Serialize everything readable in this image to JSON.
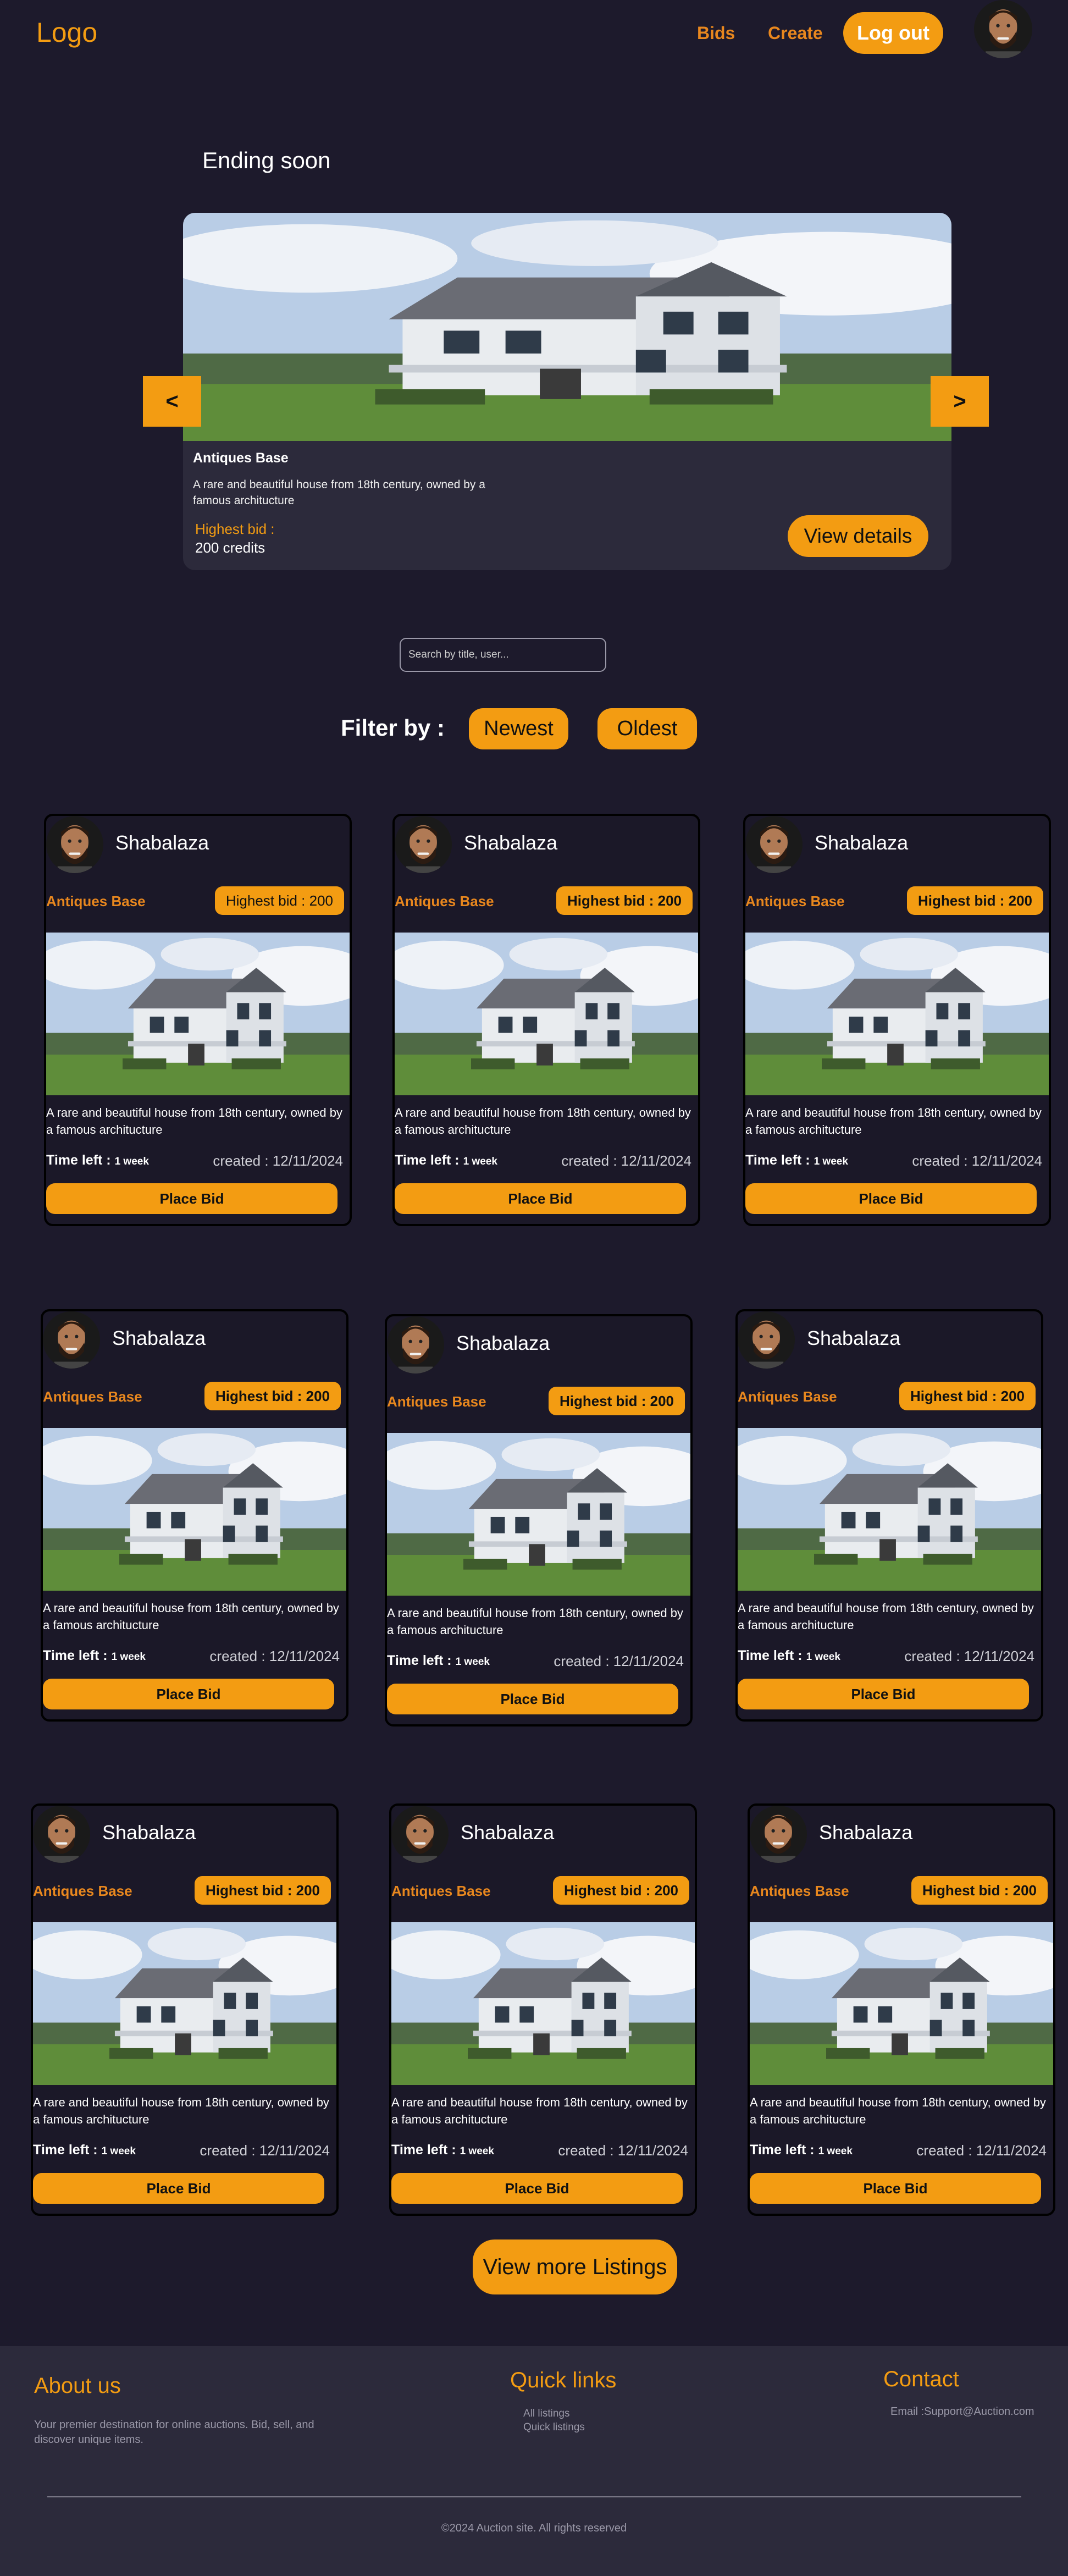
{
  "header": {
    "logo": "Logo",
    "nav": {
      "bids": "Bids",
      "create": "Create",
      "logout": "Log out"
    }
  },
  "ending_soon": {
    "title": "Ending soon",
    "prev": "<",
    "next": ">",
    "item": {
      "name": "Antiques Base",
      "description": "A rare and beautiful house from 18th century, owned by a famous architucture",
      "highest_bid_label": "Highest bid :",
      "highest_bid_value": "200 credits",
      "details_label": "View details"
    }
  },
  "search": {
    "placeholder": "Search by title, user..."
  },
  "filter": {
    "label": "Filter by :",
    "newest": "Newest",
    "oldest": "Oldest"
  },
  "cards": [
    {
      "user": "Shabalaza",
      "name": "Antiques Base",
      "highest_bid": "Highest bid : 200",
      "description": "A rare and beautiful house from 18th century, owned by a famous architucture",
      "time_left_label": "Time left :",
      "time_left_value": "1 week",
      "created": "created : 12/11/2024",
      "bid_label": "Place Bid"
    },
    {
      "user": "Shabalaza",
      "name": "Antiques Base",
      "highest_bid": "Highest bid : 200",
      "description": "A rare and beautiful house from 18th century, owned by a famous architucture",
      "time_left_label": "Time left :",
      "time_left_value": "1 week",
      "created": "created : 12/11/2024",
      "bid_label": "Place Bid"
    },
    {
      "user": "Shabalaza",
      "name": "Antiques Base",
      "highest_bid": "Highest bid : 200",
      "description": "A rare and beautiful house from 18th century, owned by a famous architucture",
      "time_left_label": "Time left :",
      "time_left_value": "1 week",
      "created": "created : 12/11/2024",
      "bid_label": "Place Bid"
    },
    {
      "user": "Shabalaza",
      "name": "Antiques Base",
      "highest_bid": "Highest bid : 200",
      "description": "A rare and beautiful house from 18th century, owned by a famous architucture",
      "time_left_label": "Time left :",
      "time_left_value": "1 week",
      "created": "created : 12/11/2024",
      "bid_label": "Place Bid"
    },
    {
      "user": "Shabalaza",
      "name": "Antiques Base",
      "highest_bid": "Highest bid : 200",
      "description": "A rare and beautiful house from 18th century, owned by a famous architucture",
      "time_left_label": "Time left :",
      "time_left_value": "1 week",
      "created": "created : 12/11/2024",
      "bid_label": "Place Bid"
    },
    {
      "user": "Shabalaza",
      "name": "Antiques Base",
      "highest_bid": "Highest bid : 200",
      "description": "A rare and beautiful house from 18th century, owned by a famous architucture",
      "time_left_label": "Time left :",
      "time_left_value": "1 week",
      "created": "created : 12/11/2024",
      "bid_label": "Place Bid"
    },
    {
      "user": "Shabalaza",
      "name": "Antiques Base",
      "highest_bid": "Highest bid : 200",
      "description": "A rare and beautiful house from 18th century, owned by a famous architucture",
      "time_left_label": "Time left :",
      "time_left_value": "1 week",
      "created": "created : 12/11/2024",
      "bid_label": "Place Bid"
    },
    {
      "user": "Shabalaza",
      "name": "Antiques Base",
      "highest_bid": "Highest bid : 200",
      "description": "A rare and beautiful house from 18th century, owned by a famous architucture",
      "time_left_label": "Time left :",
      "time_left_value": "1 week",
      "created": "created : 12/11/2024",
      "bid_label": "Place Bid"
    },
    {
      "user": "Shabalaza",
      "name": "Antiques Base",
      "highest_bid": "Highest bid : 200",
      "description": "A rare and beautiful house from 18th century, owned by a famous architucture",
      "time_left_label": "Time left :",
      "time_left_value": "1 week",
      "created": "created : 12/11/2024",
      "bid_label": "Place Bid"
    }
  ],
  "view_more": "View more Listings",
  "footer": {
    "about_title": "About us",
    "about_text": "Your premier destination for online auctions. Bid, sell, and discover unique items.",
    "quick_links_title": "Quick links",
    "quick_links": [
      "All listings",
      "Quick listings"
    ],
    "contact_title": "Contact",
    "contact_email": "Email :Support@Auction.com",
    "copyright": "©2024 Auction site. All rights reserved"
  },
  "colors": {
    "background": "#1d1a2c",
    "surface": "#2c2a3b",
    "accent": "#f39c12"
  }
}
